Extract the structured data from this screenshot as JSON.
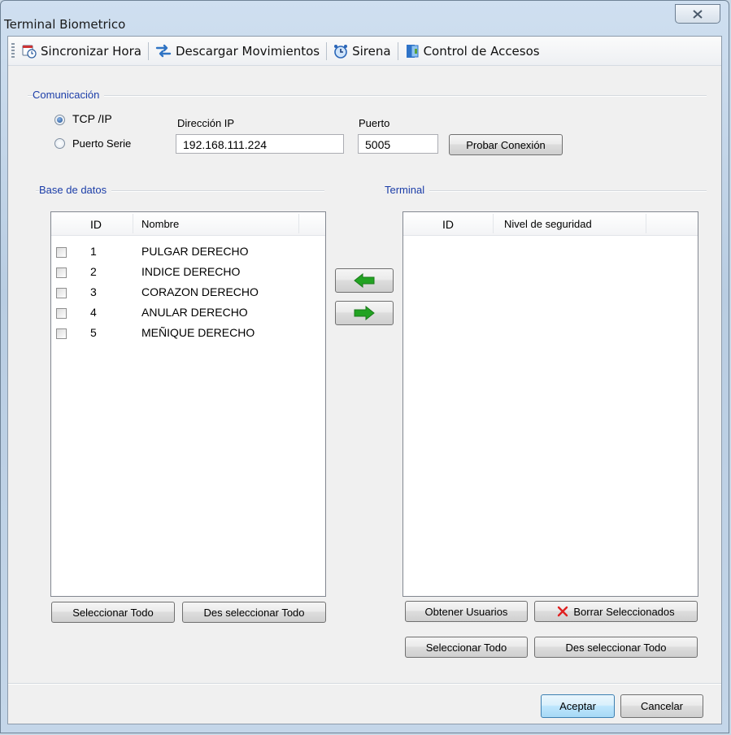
{
  "window": {
    "title": "Terminal Biometrico"
  },
  "toolbar": {
    "sync_time": "Sincronizar Hora",
    "download": "Descargar Movimientos",
    "siren": "Sirena",
    "access": "Control de Accesos"
  },
  "communication": {
    "group_label": "Comunicación",
    "tcp_label": "TCP /IP",
    "serial_label": "Puerto Serie",
    "ip_label": "Dirección IP",
    "ip_value": "192.168.111.224",
    "port_label": "Puerto",
    "port_value": "5005",
    "test_button": "Probar Conexión"
  },
  "database": {
    "group_label": "Base de datos",
    "col_id": "ID",
    "col_name": "Nombre",
    "rows": [
      {
        "id": "1",
        "name": "PULGAR DERECHO"
      },
      {
        "id": "2",
        "name": "INDICE DERECHO"
      },
      {
        "id": "3",
        "name": "CORAZON DERECHO"
      },
      {
        "id": "4",
        "name": "ANULAR DERECHO"
      },
      {
        "id": "5",
        "name": "MEÑIQUE DERECHO"
      }
    ],
    "select_all": "Seleccionar Todo",
    "deselect_all": "Des seleccionar Todo"
  },
  "terminal": {
    "group_label": "Terminal",
    "col_id": "ID",
    "col_level": "Nivel de seguridad",
    "get_users": "Obtener Usuarios",
    "delete_selected": "Borrar Seleccionados",
    "select_all": "Seleccionar Todo",
    "deselect_all": "Des seleccionar Todo"
  },
  "footer": {
    "ok": "Aceptar",
    "cancel": "Cancelar"
  },
  "colors": {
    "accent": "#1b3da8",
    "arrow_green": "#22a322",
    "delete_red": "#e02020"
  }
}
